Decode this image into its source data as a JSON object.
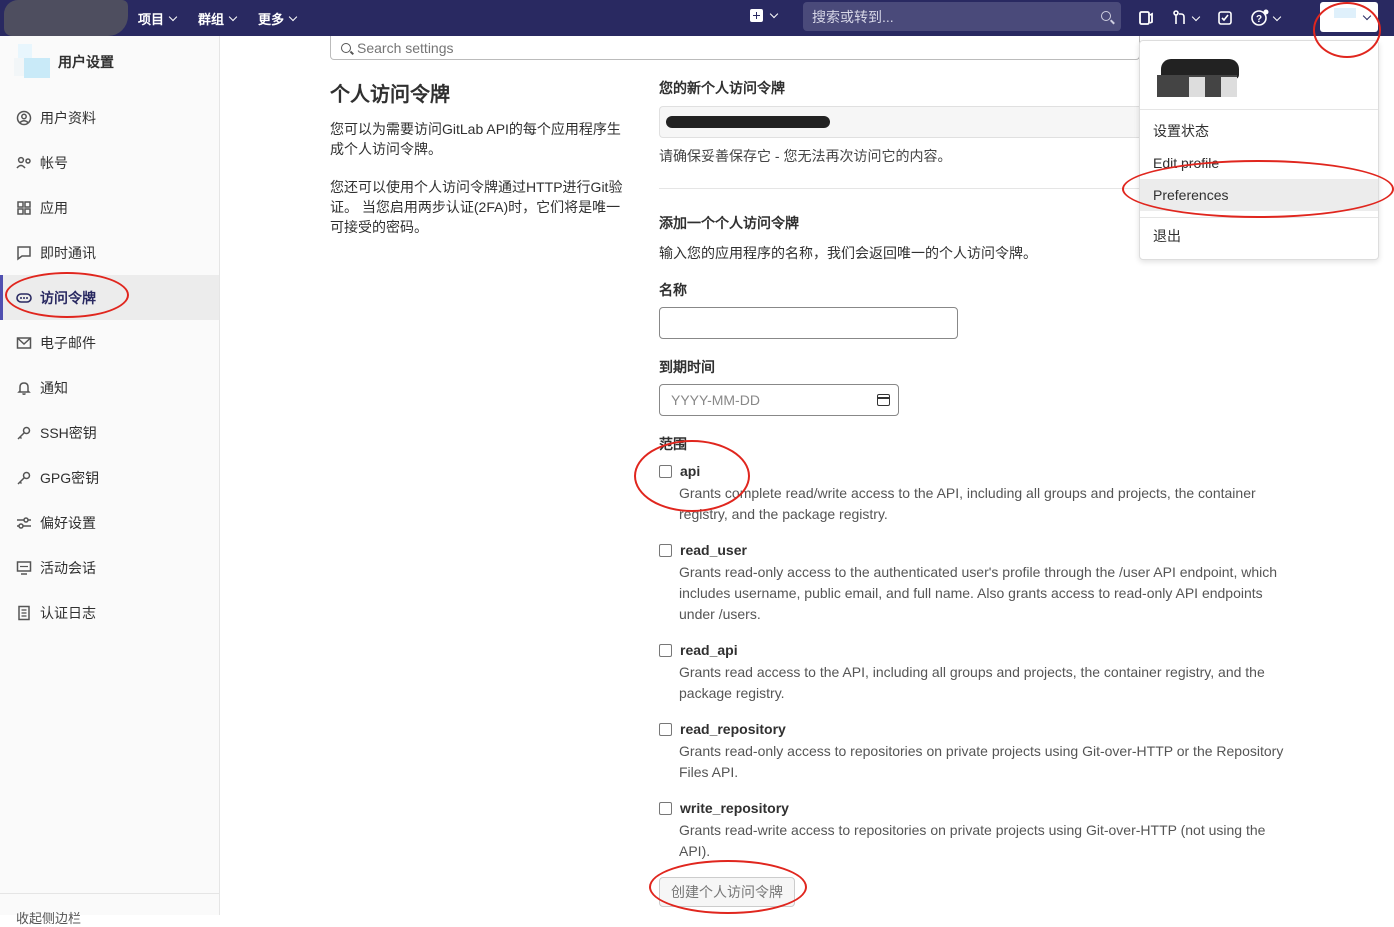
{
  "navbar": {
    "menus": [
      "项目",
      "群组",
      "更多"
    ],
    "search_placeholder": "搜索或转到...",
    "colors": {
      "bg": "#292961",
      "search_bg": "#4a4a7a"
    }
  },
  "sidebar": {
    "title": "用户设置",
    "items": [
      {
        "label": "用户资料",
        "icon": "user-circle-icon"
      },
      {
        "label": "帐号",
        "icon": "account-icon"
      },
      {
        "label": "应用",
        "icon": "applications-icon"
      },
      {
        "label": "即时通讯",
        "icon": "chat-icon"
      },
      {
        "label": "访问令牌",
        "icon": "token-icon"
      },
      {
        "label": "电子邮件",
        "icon": "mail-icon"
      },
      {
        "label": "通知",
        "icon": "bell-icon"
      },
      {
        "label": "SSH密钥",
        "icon": "key-icon"
      },
      {
        "label": "GPG密钥",
        "icon": "key-icon"
      },
      {
        "label": "偏好设置",
        "icon": "preferences-icon"
      },
      {
        "label": "活动会话",
        "icon": "monitor-icon"
      },
      {
        "label": "认证日志",
        "icon": "log-icon"
      }
    ],
    "active_index": 4,
    "footer": "收起侧边栏"
  },
  "main": {
    "search_placeholder": "Search settings",
    "title": "个人访问令牌",
    "desc1": "您可以为需要访问GitLab API的每个应用程序生成个人访问令牌。",
    "desc2": "您还可以使用个人访问令牌通过HTTP进行Git验证。 当您启用两步认证(2FA)时，它们将是唯一可接受的密码。",
    "new_token_label": "您的新个人访问令牌",
    "new_token_help": "请确保妥善保存它 - 您无法再次访问它的内容。",
    "add_title": "添加一个个人访问令牌",
    "add_desc": "输入您的应用程序的名称，我们会返回唯一的个人访问令牌。",
    "name_label": "名称",
    "expiry_label": "到期时间",
    "expiry_placeholder": "YYYY-MM-DD",
    "scopes_label": "范围",
    "scopes": [
      {
        "name": "api",
        "desc": "Grants complete read/write access to the API, including all groups and projects, the container registry, and the package registry."
      },
      {
        "name": "read_user",
        "desc": "Grants read-only access to the authenticated user's profile through the /user API endpoint, which includes username, public email, and full name. Also grants access to read-only API endpoints under /users."
      },
      {
        "name": "read_api",
        "desc": "Grants read access to the API, including all groups and projects, the container registry, and the package registry."
      },
      {
        "name": "read_repository",
        "desc": "Grants read-only access to repositories on private projects using Git-over-HTTP or the Repository Files API."
      },
      {
        "name": "write_repository",
        "desc": "Grants read-write access to repositories on private projects using Git-over-HTTP (not using the API)."
      }
    ],
    "create_button": "创建个人访问令牌"
  },
  "dropdown": {
    "items": [
      "设置状态",
      "Edit profile",
      "Preferences",
      "退出"
    ]
  },
  "annotation_color": "#e0261e"
}
